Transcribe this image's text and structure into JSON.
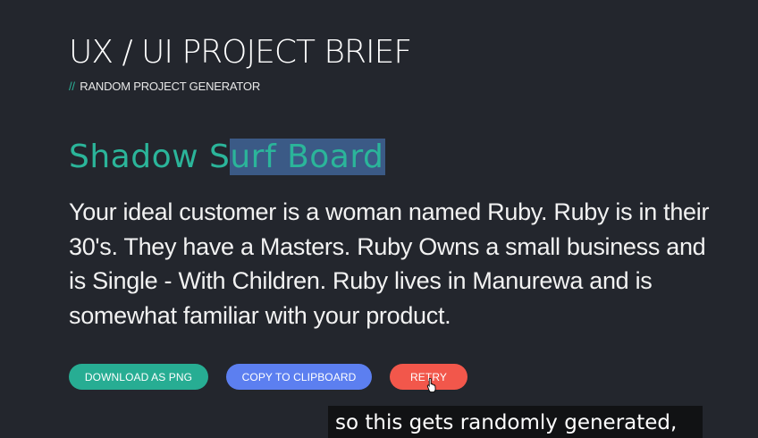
{
  "header": {
    "title": "UX / UI PROJECT BRIEF",
    "subtitle_prefix": "//",
    "subtitle": "RANDOM PROJECT GENERATOR"
  },
  "project": {
    "name_unselected": "Shadow S",
    "name_selected": "urf Board",
    "description": "Your ideal customer is a woman named Ruby. Ruby is in their 30's. They have a Masters. Ruby Owns a small business and is Single - With Children. Ruby lives in Manurewa and is somewhat familiar with your product."
  },
  "actions": {
    "download_label": "DOWNLOAD AS PNG",
    "copy_label": "COPY TO CLIPBOARD",
    "retry_label": "RETRY"
  },
  "caption": {
    "text": "so this gets randomly generated,"
  },
  "colors": {
    "background": "#23262d",
    "accent_teal": "#27ad93",
    "accent_blue": "#5c7ff0",
    "accent_red": "#f2574b",
    "selection": "#3b5a86"
  }
}
